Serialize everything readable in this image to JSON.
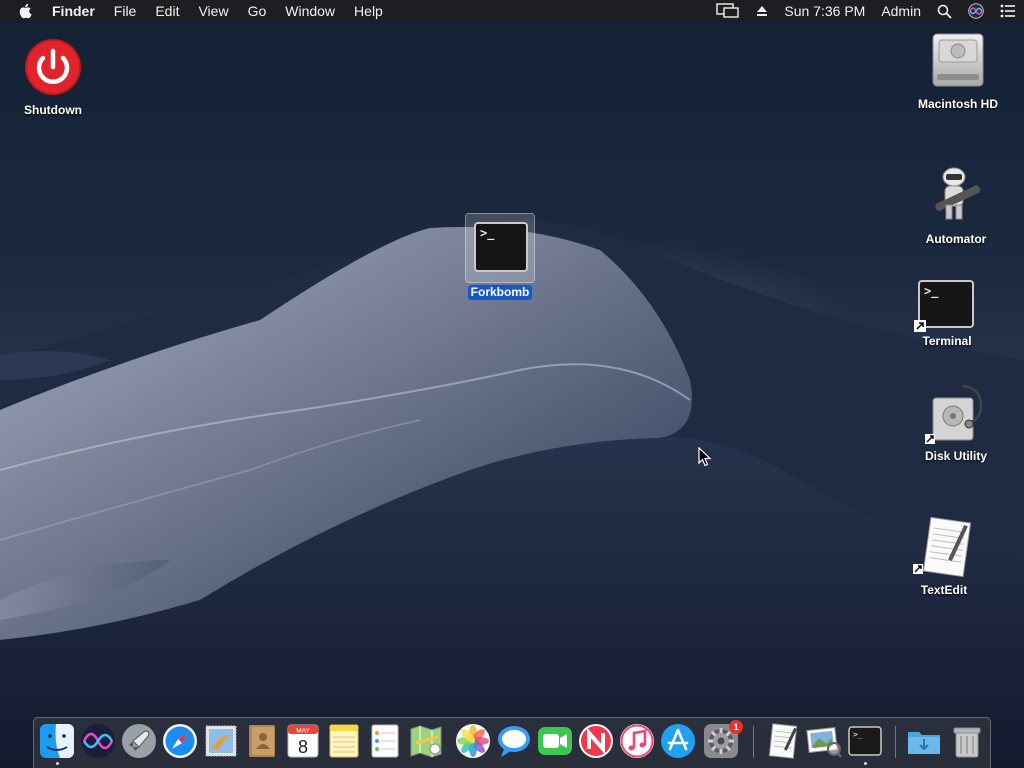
{
  "menubar": {
    "app_name": "Finder",
    "menus": [
      "File",
      "Edit",
      "View",
      "Go",
      "Window",
      "Help"
    ],
    "clock": "Sun 7:36 PM",
    "user": "Admin",
    "status_icons": [
      "display-mirroring-icon",
      "eject-icon",
      "spotlight-search-icon",
      "siri-icon",
      "notification-center-icon"
    ]
  },
  "desktop": {
    "shutdown": "Shutdown",
    "forkbomb": "Forkbomb",
    "macintosh_hd": "Macintosh HD",
    "automator": "Automator",
    "terminal": "Terminal",
    "disk_utility": "Disk Utility",
    "textedit": "TextEdit",
    "terminal_prompt": ">_"
  },
  "dock": {
    "items": [
      "Finder",
      "Siri",
      "Launchpad",
      "Safari",
      "Mail",
      "Contacts",
      "Calendar",
      "Notes",
      "Reminders",
      "Maps",
      "Photos",
      "Messages",
      "FaceTime",
      "News",
      "iTunes",
      "App Store",
      "System Preferences",
      "TextEdit",
      "Preview",
      "Terminal",
      "Downloads",
      "Trash"
    ],
    "calendar_month": "MAY",
    "calendar_day": "8",
    "system_prefs_badge": "1"
  }
}
